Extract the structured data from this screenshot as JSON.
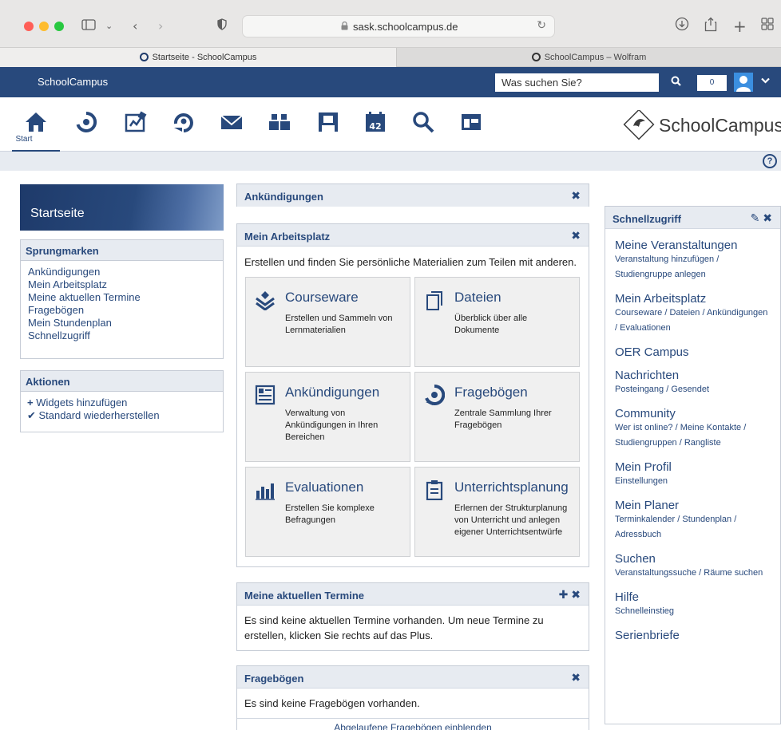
{
  "browser": {
    "url": "sask.schoolcampus.de",
    "tabs": [
      {
        "label": "Startseite - SchoolCampus"
      },
      {
        "label": "SchoolCampus – Wolfram"
      }
    ]
  },
  "topbar": {
    "brand": "SchoolCampus",
    "search_placeholder": "Was suchen Sie?",
    "notification_count": "0"
  },
  "nav": {
    "start_label": "Start",
    "logo_text": "SchoolCampus"
  },
  "sidebar": {
    "title": "Startseite",
    "jump_title": "Sprungmarken",
    "jump_links": [
      "Ankündigungen",
      "Mein Arbeitsplatz",
      "Meine aktuellen Termine",
      "Fragebögen",
      "Mein Stundenplan",
      "Schnellzugriff"
    ],
    "actions_title": "Aktionen",
    "actions": [
      {
        "icon": "plus-icon",
        "label": "Widgets hinzufügen"
      },
      {
        "icon": "check-icon",
        "label": "Standard wiederherstellen"
      }
    ]
  },
  "announcements": {
    "title": "Ankündigungen"
  },
  "workplace": {
    "title": "Mein Arbeitsplatz",
    "intro": "Erstellen und finden Sie persönliche Materialien zum Teilen mit anderen.",
    "tiles": [
      {
        "icon": "courseware-icon",
        "title": "Courseware",
        "desc": "Erstellen und Sammeln von Lernmaterialien"
      },
      {
        "icon": "files-icon",
        "title": "Dateien",
        "desc": "Überblick über alle Dokumente"
      },
      {
        "icon": "announcement-icon",
        "title": "Ankündigungen",
        "desc": "Verwaltung von Ankündigungen in Ihren Bereichen"
      },
      {
        "icon": "questionnaire-icon",
        "title": "Fragebögen",
        "desc": "Zentrale Sammlung Ihrer Fragebögen"
      },
      {
        "icon": "evaluation-icon",
        "title": "Evaluationen",
        "desc": "Erstellen Sie komplexe Befragungen"
      },
      {
        "icon": "clipboard-icon",
        "title": "Unterrichtsplanung",
        "desc": "Erlernen der Strukturplanung von Unterricht und anlegen eigener Unterrichtsentwürfe"
      }
    ]
  },
  "dates": {
    "title": "Meine aktuellen Termine",
    "text": "Es sind keine aktuellen Termine vorhanden. Um neue Termine zu erstellen, klicken Sie rechts auf das Plus."
  },
  "questionnaires": {
    "title": "Fragebögen",
    "text": "Es sind keine Fragebögen vorhanden.",
    "link": "Abgelaufene Fragebögen einblenden"
  },
  "quickaccess": {
    "title": "Schnellzugriff",
    "items": [
      {
        "title": "Meine Veranstaltungen",
        "sub": "Veranstaltung hinzufügen / Studiengruppe anlegen"
      },
      {
        "title": "Mein Arbeitsplatz",
        "sub": "Courseware / Dateien / Ankündigungen / Evaluationen"
      },
      {
        "title": "OER Campus",
        "sub": ""
      },
      {
        "title": "Nachrichten",
        "sub": "Posteingang / Gesendet"
      },
      {
        "title": "Community",
        "sub": "Wer ist online? / Meine Kontakte / Studiengruppen / Rangliste"
      },
      {
        "title": "Mein Profil",
        "sub": "Einstellungen"
      },
      {
        "title": "Mein Planer",
        "sub": "Terminkalender / Stundenplan / Adressbuch"
      },
      {
        "title": "Suchen",
        "sub": "Veranstaltungssuche / Räume suchen"
      },
      {
        "title": "Hilfe",
        "sub": "Schnelleinstieg"
      },
      {
        "title": "Serienbriefe",
        "sub": ""
      }
    ]
  },
  "colors": {
    "primary": "#28497c",
    "panel": "#e7ebf1",
    "tile": "#f0f0f0"
  }
}
